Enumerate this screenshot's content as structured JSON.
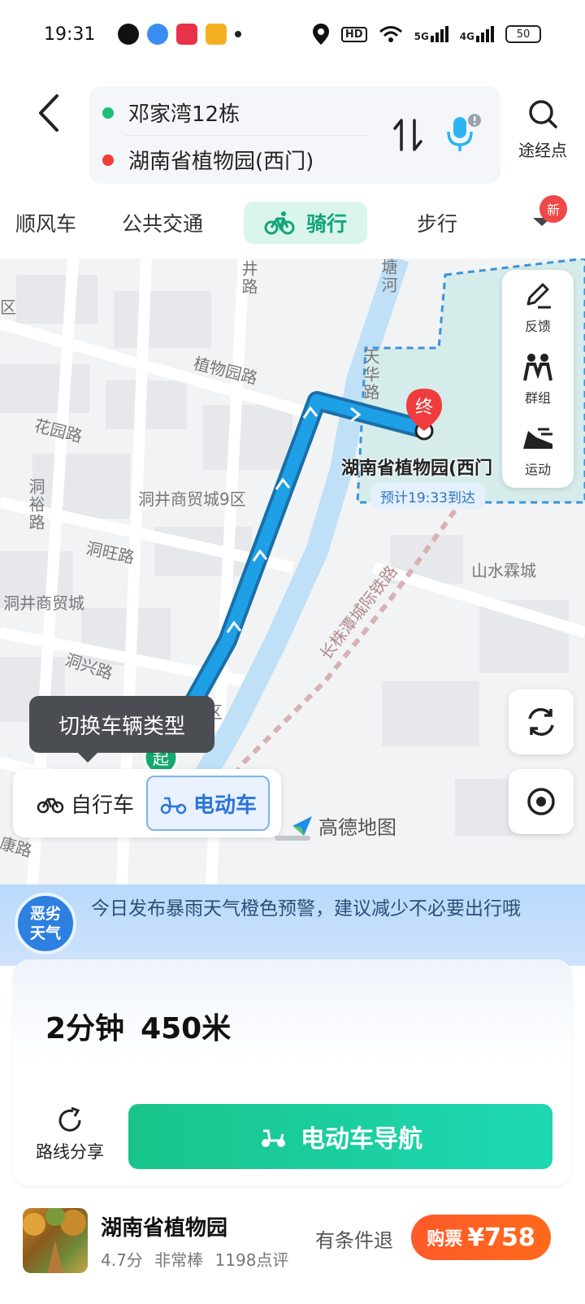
{
  "status_bar": {
    "time": "19:31",
    "network_labels": [
      "5G",
      "4G"
    ],
    "hd_label": "HD",
    "battery": "50"
  },
  "header": {
    "start": "邓家湾12栋",
    "end": "湖南省植物园(西门)",
    "waypoint_label": "途经点"
  },
  "tabs": {
    "items": [
      "顺风车",
      "公共交通",
      "骑行",
      "步行"
    ],
    "active": "骑行",
    "new_badge": "新"
  },
  "map": {
    "road_labels": {
      "jing_road": "井路",
      "zhiwuyuan_road": "植物园路",
      "huayuan_road": "花园路",
      "tianhua_road": "天华路",
      "tang_river": "塘河",
      "dongjing_mall_9": "洞井商贸城9区",
      "dongyu_road": "洞裕路",
      "dongwang_road": "洞旺路",
      "dongjing_mall": "洞井商贸城",
      "shanshui_linecheng": "山水霖城",
      "railway": "长株潭城际铁路",
      "dongxing_road": "洞兴路",
      "district_left": "区",
      "district_mid": "区",
      "kang_road": "康路"
    },
    "end_marker": "终",
    "start_marker": "起",
    "destination_label": "湖南省植物园(西门",
    "eta": "预计19:33到达",
    "tools": [
      "反馈",
      "群组",
      "运动"
    ],
    "tooltip": "切换车辆类型",
    "vehicle_options": [
      "自行车",
      "电动车"
    ],
    "vehicle_active": "电动车",
    "watermark": "高德地图"
  },
  "weather": {
    "badge_line1": "恶劣",
    "badge_line2": "天气",
    "text": "今日发布暴雨天气橙色预警，建议减少不必要出行哦"
  },
  "route_card": {
    "duration": "2分钟",
    "distance": "450米",
    "share_label": "路线分享",
    "nav_label": "电动车导航"
  },
  "poi": {
    "name": "湖南省植物园",
    "rating": "4.7分",
    "rating_desc": "非常棒",
    "reviews": "1198点评",
    "refund": "有条件退",
    "buy_label": "购票",
    "price": "¥758"
  },
  "colors": {
    "accent_green": "#12a47a",
    "route_blue": "#1ea0e6",
    "end_red": "#f03c3c",
    "buy_orange": "#ff5a2a"
  }
}
